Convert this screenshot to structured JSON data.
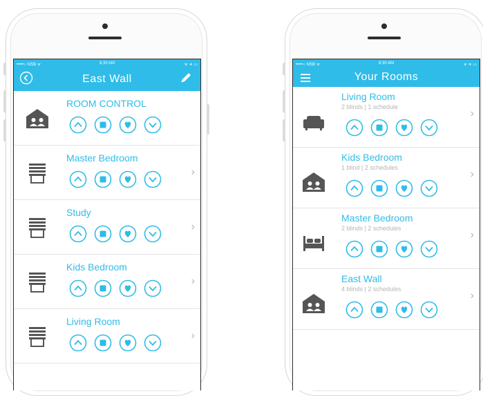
{
  "colors": {
    "accent": "#2fbce8",
    "icon_gray": "#555555",
    "muted_text": "#b5b5b5",
    "chevron": "#b4b4b4"
  },
  "status_bar": {
    "carrier": "•••••○ NSB ᯤ",
    "time": "8:30 AM",
    "battery": "ᯤ ∗ ▭"
  },
  "left_screen": {
    "title": "East Wall",
    "back_icon": "circle-back-icon",
    "edit_icon": "pencil-icon",
    "rooms": [
      {
        "name": "ROOM CONTROL",
        "icon": "house-people-icon",
        "has_chevron": false
      },
      {
        "name": "Master Bedroom",
        "icon": "blind-icon",
        "has_chevron": true
      },
      {
        "name": "Study",
        "icon": "blind-icon",
        "has_chevron": true
      },
      {
        "name": "Kids Bedroom",
        "icon": "blind-icon",
        "has_chevron": true
      },
      {
        "name": "Living Room",
        "icon": "blind-icon",
        "has_chevron": true
      }
    ]
  },
  "right_screen": {
    "title": "Your Rooms",
    "menu_icon": "hamburger-menu-icon",
    "rooms": [
      {
        "name": "Living Room",
        "sub": "2 blinds | 1 schedule",
        "icon": "sofa-icon"
      },
      {
        "name": "Kids Bedroom",
        "sub": "1 blind | 2 schedules",
        "icon": "house-people-icon"
      },
      {
        "name": "Master Bedroom",
        "sub": "2 blinds | 2 schedules",
        "icon": "bed-icon"
      },
      {
        "name": "East Wall",
        "sub": "4 blinds | 2 schedules",
        "icon": "house-people-icon"
      }
    ]
  },
  "controls": [
    {
      "name": "up-button",
      "icon": "chevron-up-icon"
    },
    {
      "name": "stop-button",
      "icon": "stop-square-icon"
    },
    {
      "name": "favourite-button",
      "icon": "heart-icon"
    },
    {
      "name": "down-button",
      "icon": "chevron-down-icon"
    }
  ],
  "chevron_glyph": "›"
}
